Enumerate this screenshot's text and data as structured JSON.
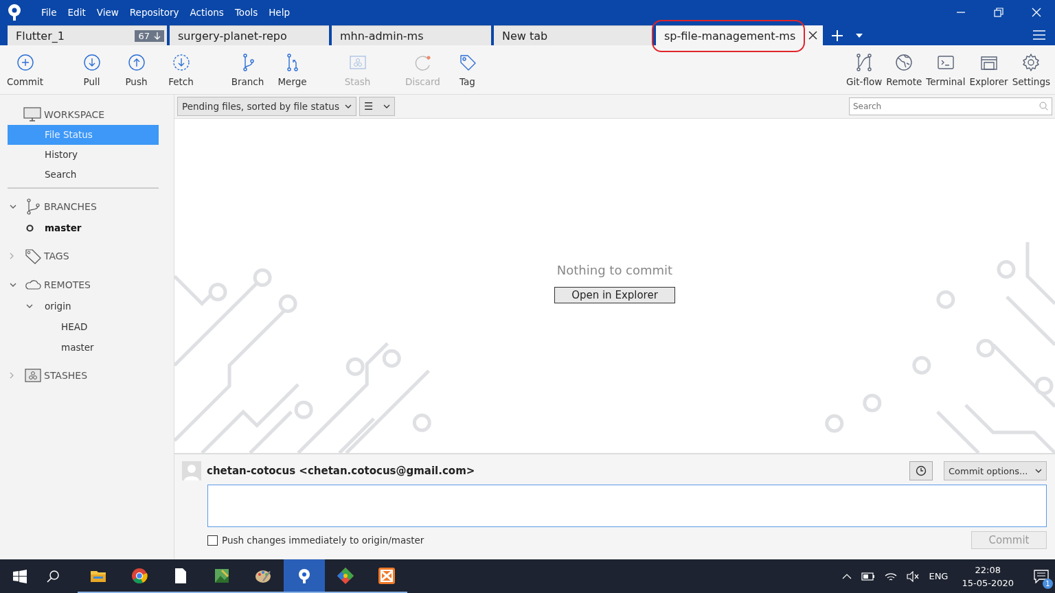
{
  "menu": [
    "File",
    "Edit",
    "View",
    "Repository",
    "Actions",
    "Tools",
    "Help"
  ],
  "tabs": [
    {
      "label": "Flutter_1",
      "badge": "67",
      "selected": false
    },
    {
      "label": "surgery-planet-repo",
      "selected": false
    },
    {
      "label": "mhn-admin-ms",
      "selected": false
    },
    {
      "label": "New tab",
      "selected": false
    },
    {
      "label": "sp-file-management-ms",
      "selected": true,
      "circled": true
    }
  ],
  "toolbar_left": [
    {
      "label": "Commit",
      "disabled": false
    },
    {
      "label": "Pull",
      "disabled": false
    },
    {
      "label": "Push",
      "disabled": false
    },
    {
      "label": "Fetch",
      "disabled": false
    },
    {
      "label": "Branch",
      "disabled": false
    },
    {
      "label": "Merge",
      "disabled": false
    },
    {
      "label": "Stash",
      "disabled": true
    },
    {
      "label": "Discard",
      "disabled": true
    },
    {
      "label": "Tag",
      "disabled": false
    }
  ],
  "toolbar_right": [
    {
      "label": "Git-flow"
    },
    {
      "label": "Remote"
    },
    {
      "label": "Terminal"
    },
    {
      "label": "Explorer"
    },
    {
      "label": "Settings"
    }
  ],
  "sidebar": {
    "workspace": {
      "title": "WORKSPACE",
      "items": [
        {
          "label": "File Status",
          "selected": true
        },
        {
          "label": "History",
          "selected": false
        },
        {
          "label": "Search",
          "selected": false
        }
      ]
    },
    "sections": [
      {
        "title": "BRANCHES",
        "expanded": true,
        "children": [
          {
            "label": "master",
            "current": true
          }
        ]
      },
      {
        "title": "TAGS",
        "expanded": false
      },
      {
        "title": "REMOTES",
        "expanded": true,
        "children": [
          {
            "label": "origin",
            "expanded": true,
            "children": [
              {
                "label": "HEAD"
              },
              {
                "label": "master"
              }
            ]
          }
        ]
      },
      {
        "title": "STASHES",
        "expanded": false
      }
    ]
  },
  "file_bar": {
    "sort": "Pending files, sorted by file status",
    "view_icon": "☰",
    "search": {
      "placeholder": "Search"
    }
  },
  "empty": {
    "message": "Nothing to commit",
    "button": "Open in Explorer"
  },
  "commit": {
    "author": "chetan-cotocus <chetan.cotocus@gmail.com>",
    "options": "Commit options...",
    "push": {
      "label": "Push changes immediately to origin/master",
      "checked": false
    },
    "button": {
      "label": "Commit",
      "disabled": true
    }
  },
  "taskbar": {
    "apps": [
      {
        "selected": false
      },
      {
        "selected": false
      },
      {
        "selected": false
      },
      {
        "selected": false
      },
      {
        "selected": false
      },
      {
        "selected": true
      },
      {
        "selected": false
      },
      {
        "selected": false
      }
    ],
    "language": "ENG",
    "time": "22:08",
    "date": "15-05-2020",
    "notifications": "1"
  }
}
